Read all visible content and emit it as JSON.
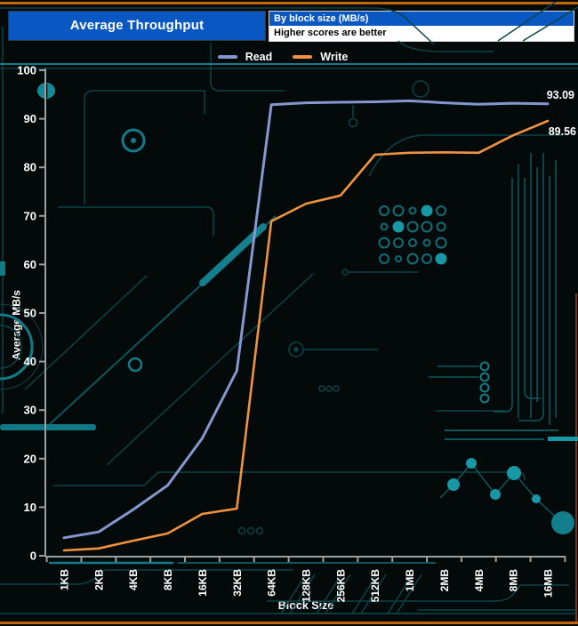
{
  "header": {
    "title": "Average Throughput",
    "info_line1": "By block size (MB/s)",
    "info_line2": "Higher scores are better"
  },
  "chart_data": {
    "type": "line",
    "title": "Average Throughput",
    "subtitle": "By block size (MB/s)",
    "note": "Higher scores are better",
    "categories": [
      "1KB",
      "2KB",
      "4KB",
      "8KB",
      "16KB",
      "32KB",
      "64KB",
      "128KB",
      "256KB",
      "512KB",
      "1MB",
      "2MB",
      "4MB",
      "8MB",
      "16MB"
    ],
    "series": [
      {
        "name": "Read",
        "color": "#8498cf",
        "values": [
          3.7,
          4.9,
          9.5,
          14.5,
          24.2,
          38.1,
          92.9,
          93.3,
          93.4,
          93.5,
          93.7,
          93.3,
          93.0,
          93.2,
          93.09
        ],
        "end_label": "93.09"
      },
      {
        "name": "Write",
        "color": "#ef9340",
        "values": [
          1.1,
          1.5,
          3.1,
          4.6,
          8.6,
          9.7,
          68.9,
          72.5,
          74.2,
          82.6,
          83.0,
          83.1,
          83.0,
          86.6,
          89.56
        ],
        "end_label": "89.56"
      }
    ],
    "xlabel": "Block Size",
    "ylabel": "Average MB/s",
    "ylim": [
      0,
      100
    ],
    "ytick_step": 10,
    "grid": false,
    "legend_position": "top-center"
  },
  "colors": {
    "background": "#040909",
    "header_blue": "#0857c3",
    "border_orange": "#c2660a",
    "axis_gray": "#9aa0a0",
    "read_line": "#8498cf",
    "write_line": "#ef9340",
    "circuit_dim": "#0b4448",
    "circuit_mid": "#0d575c",
    "circuit_bright": "#117c87",
    "circuit_fill": "#1897a5"
  }
}
